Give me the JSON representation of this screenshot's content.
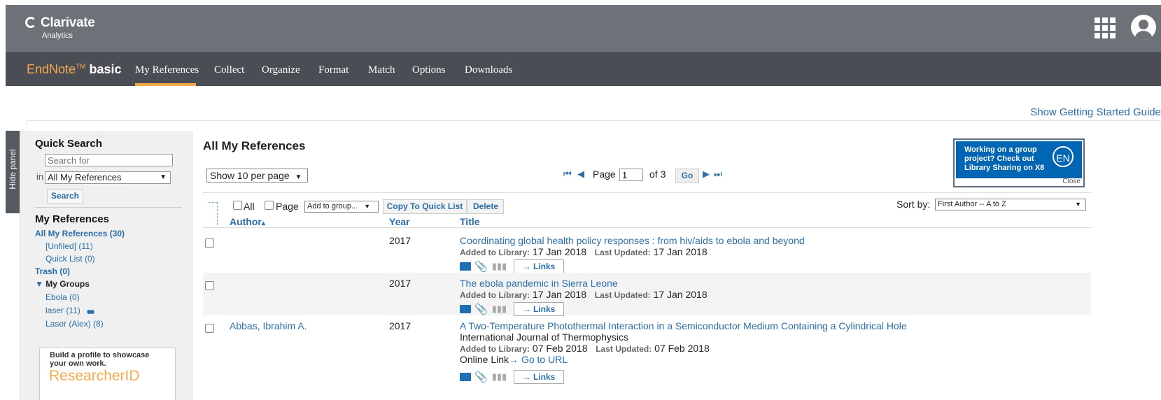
{
  "header": {
    "logo_name": "Clarivate",
    "logo_sub": "Analytics",
    "apps_icon": "apps-grid-icon",
    "avatar_icon": "user-avatar-icon"
  },
  "nav": {
    "brand_en": "EndNote",
    "brand_tm": "TM",
    "brand_basic": "basic",
    "items": [
      "My References",
      "Collect",
      "Organize",
      "Format",
      "Match",
      "Options",
      "Downloads"
    ],
    "active": "My References",
    "accent_color": "#f5a84c"
  },
  "guide_link": "Show Getting Started Guide",
  "sidebar": {
    "hide_panel": "Hide panel",
    "quick_search_title": "Quick Search",
    "search_placeholder": "Search for",
    "in_label": "in",
    "scope_value": "All My References",
    "search_button": "Search",
    "my_refs_title": "My References",
    "all_refs": "All My References (30)",
    "unfiled": "[Unfiled] (11)",
    "quick_list": "Quick List (0)",
    "trash": "Trash (0)",
    "my_groups": "My Groups",
    "groups": [
      {
        "label": "Ebola  (0)"
      },
      {
        "label": "laser  (11)"
      },
      {
        "label": "Laser (Alex)  (8)"
      }
    ],
    "researcher_promo": "Build a profile to showcase your own work.",
    "researcher_name": "ResearcherID"
  },
  "main": {
    "title": "All My References",
    "per_page": "Show 10 per page",
    "page_label": "Page",
    "page_value": "1",
    "of_label": "of 3",
    "go": "Go",
    "banner_text": "Working on a group project? Check out Library Sharing on X8",
    "banner_logo": "EN",
    "banner_close": "Close",
    "toolbar": {
      "all": "All",
      "page": "Page",
      "add_to_group": "Add to group...",
      "copy_quick_list": "Copy To Quick List",
      "delete": "Delete",
      "sort_by": "Sort by:",
      "sort_value": "First Author -- A to Z"
    },
    "columns": {
      "author": "Author",
      "year": "Year",
      "title": "Title"
    },
    "added_label": "Added to Library:",
    "updated_label": "Last Updated:",
    "links": "Links",
    "rows": [
      {
        "author": "",
        "year": "2017",
        "title": "Coordinating global health policy responses : from hiv/aids to ebola and beyond",
        "added": "17 Jan 2018",
        "updated": "17 Jan 2018"
      },
      {
        "author": "",
        "year": "2017",
        "title": "The ebola pandemic in Sierra Leone",
        "added": "17 Jan 2018",
        "updated": "17 Jan 2018"
      },
      {
        "author": "Abbas, Ibrahim A.",
        "year": "2017",
        "title": "A Two-Temperature Photothermal Interaction in a Semiconductor Medium Containing a Cylindrical Hole",
        "journal": "International Journal of Thermophysics",
        "added": "07 Feb 2018",
        "updated": "07 Feb 2018",
        "online_link": "Online Link",
        "go_to_url": "Go to URL"
      }
    ]
  }
}
